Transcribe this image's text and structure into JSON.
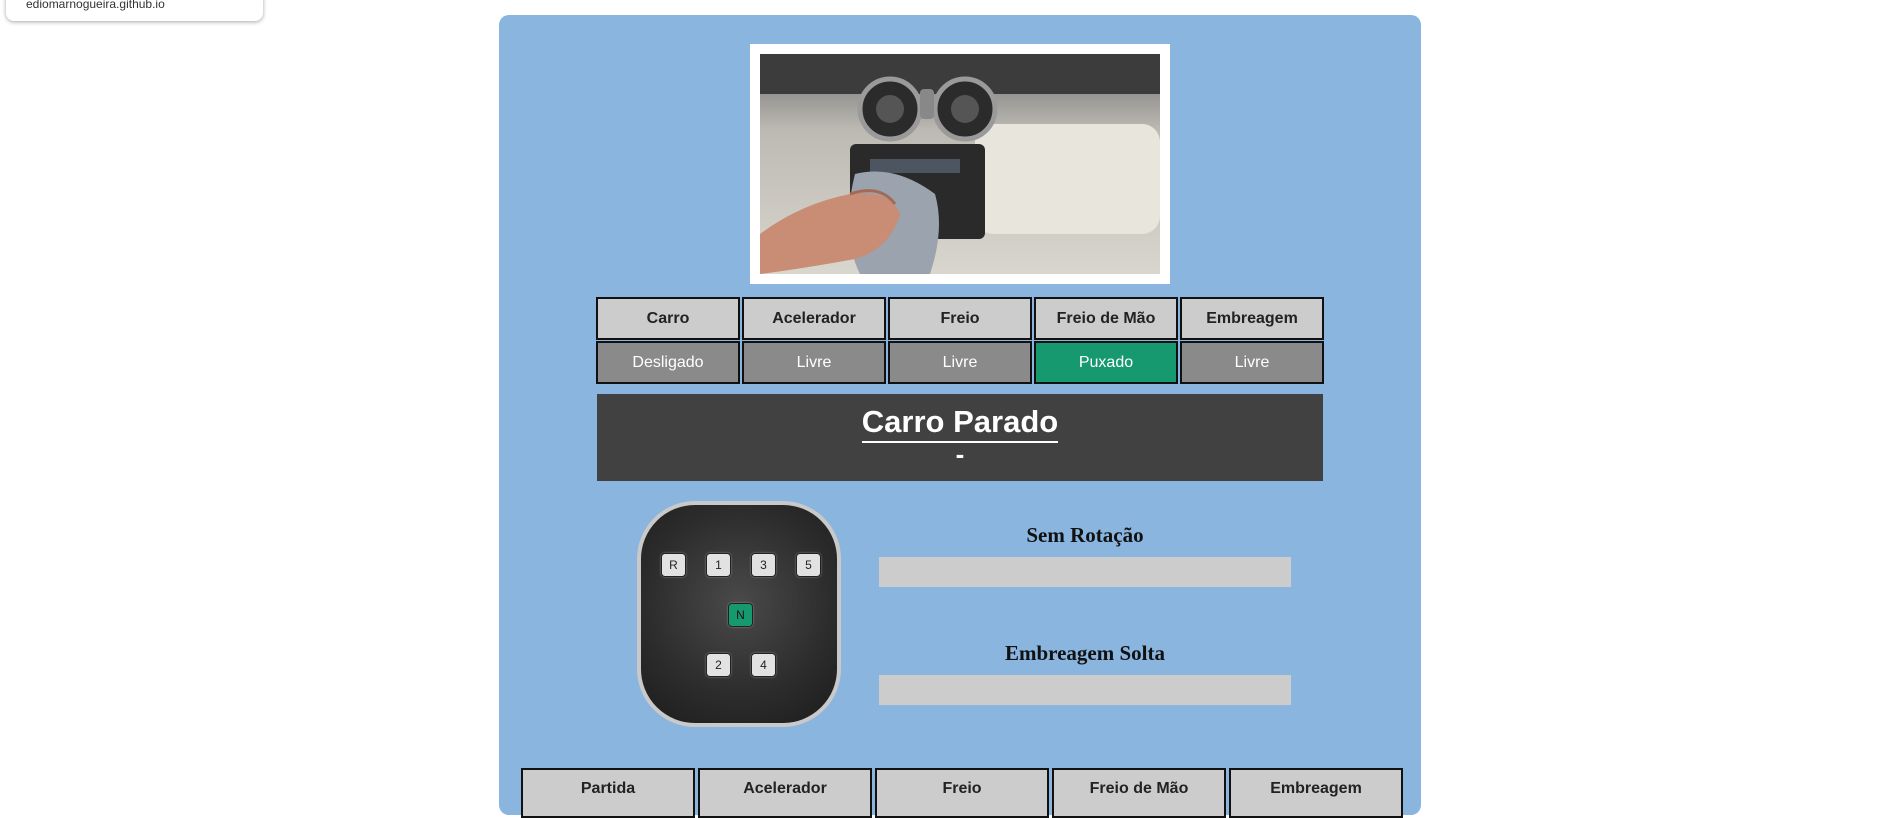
{
  "tooltip": {
    "domain": "ediomarnogueira.github.io"
  },
  "status": {
    "headers": [
      "Carro",
      "Acelerador",
      "Freio",
      "Freio de Mão",
      "Embreagem"
    ],
    "values": [
      "Desligado",
      "Livre",
      "Livre",
      "Puxado",
      "Livre"
    ],
    "active_color": "#16996f",
    "inactive_color": "#8a8a8a"
  },
  "banner": {
    "title": "Carro Parado",
    "subtitle": "-"
  },
  "shifter": {
    "gears": [
      "R",
      "1",
      "3",
      "5",
      "N",
      "2",
      "4"
    ],
    "selected": "N"
  },
  "gauges": {
    "rotation_label": "Sem Rotação",
    "rotation_level": 0,
    "clutch_label": "Embreagem Solta",
    "clutch_level": 0
  },
  "controls": {
    "buttons": [
      "Partida",
      "Acelerador",
      "Freio",
      "Freio de Mão",
      "Embreagem"
    ]
  },
  "colors": {
    "panel": "#89b5df",
    "banner": "#414141"
  }
}
